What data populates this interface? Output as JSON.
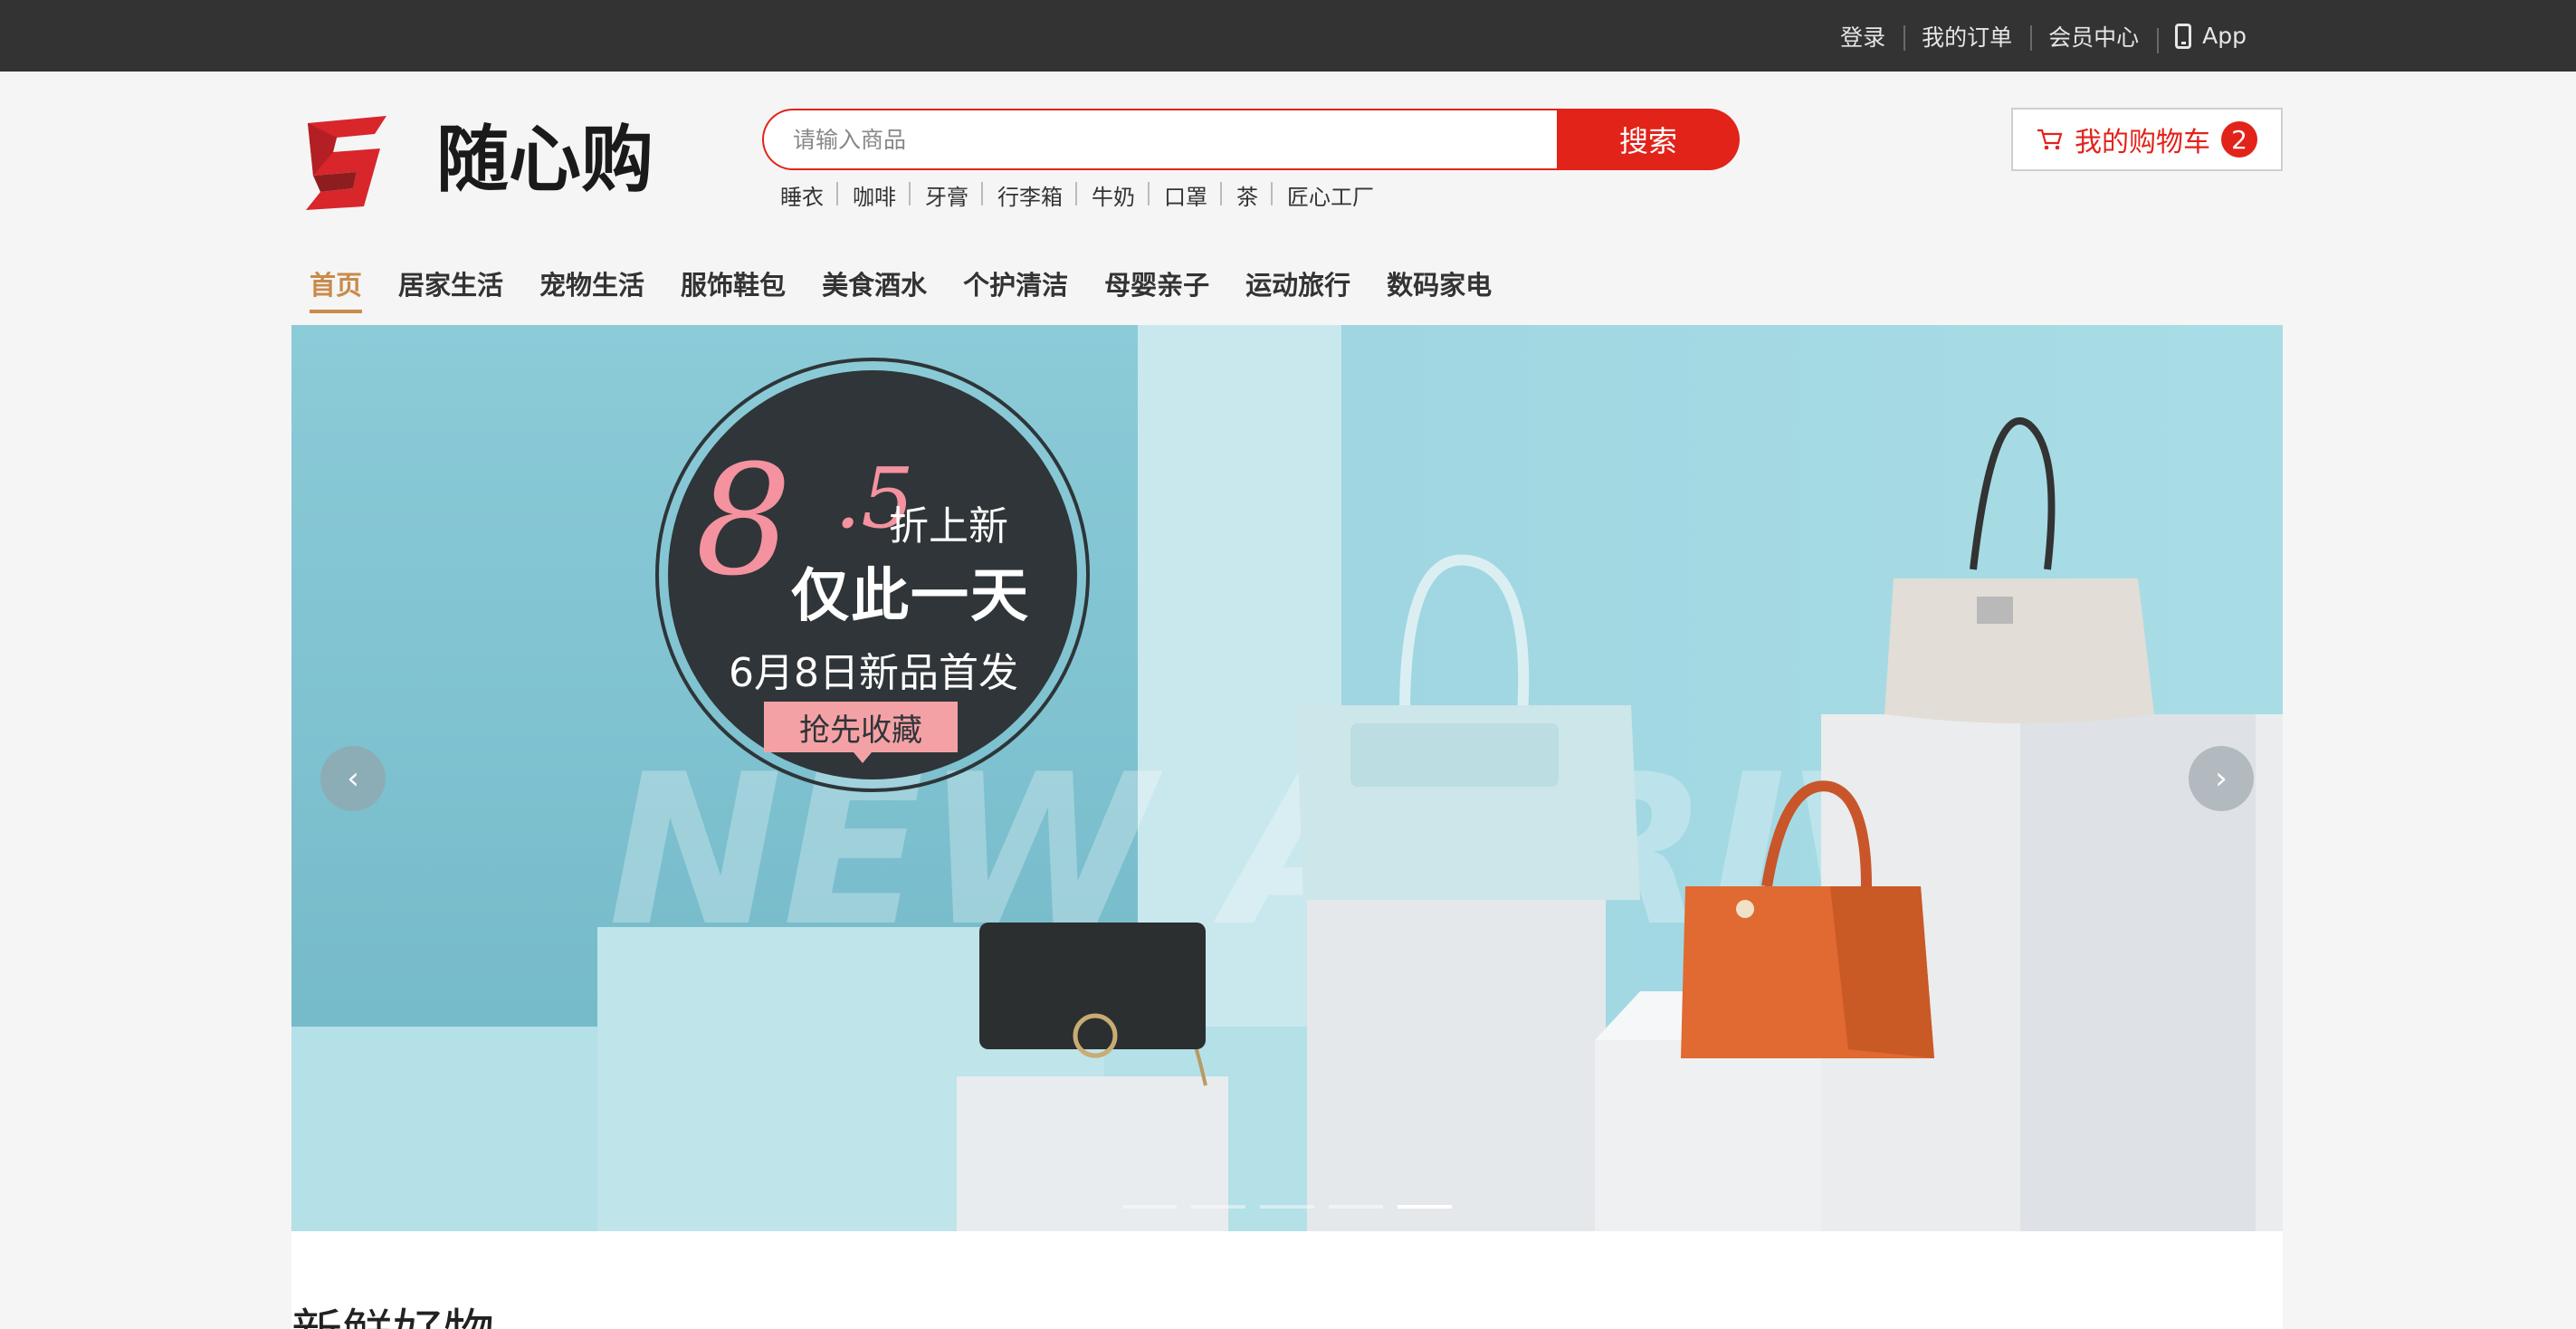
{
  "topbar": {
    "links": [
      "登录",
      "我的订单",
      "会员中心"
    ],
    "app_label": "App"
  },
  "header": {
    "logo_text": "随心购",
    "search": {
      "placeholder": "请输入商品",
      "value": "",
      "button_label": "搜索"
    },
    "hot_keywords": [
      "睡衣",
      "咖啡",
      "牙膏",
      "行李箱",
      "牛奶",
      "口罩",
      "茶",
      "匠心工厂"
    ],
    "cart": {
      "label": "我的购物车",
      "count": "2"
    }
  },
  "nav": {
    "items": [
      "首页",
      "居家生活",
      "宠物生活",
      "服饰鞋包",
      "美食酒水",
      "个护清洁",
      "母婴亲子",
      "运动旅行",
      "数码家电"
    ],
    "active_index": 0
  },
  "banner": {
    "promo_number": "8",
    "promo_decimal": ".5",
    "promo_sub": "折上新",
    "promo_main": "仅此一天",
    "promo_date": "6月8日新品首发",
    "promo_cta": "抢先收藏",
    "watermark": "NEW ARRIVAL",
    "prev_label": "‹",
    "next_label": "›",
    "slide_count": 5,
    "active_slide": 4
  },
  "section": {
    "title": "新鲜好物"
  },
  "colors": {
    "brand_red": "#e2231a",
    "nav_active": "#c98a4b",
    "topbar_bg": "#333333",
    "banner_bg": "#a6dbe4"
  },
  "icons": {
    "phone": "phone-icon",
    "cart": "cart-icon",
    "prev": "chevron-left-icon",
    "next": "chevron-right-icon"
  }
}
